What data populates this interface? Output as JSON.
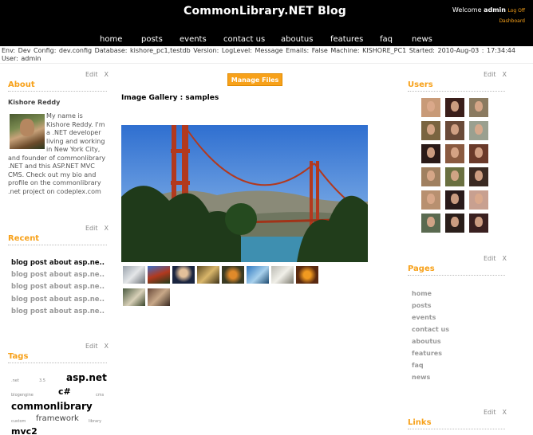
{
  "header": {
    "site_title": "CommonLibrary.NET Blog",
    "welcome_prefix": "Welcome ",
    "username": "admin",
    "logoff_label": "Log Off",
    "dashboard_label": "Dashboard"
  },
  "nav": {
    "items": [
      {
        "label": "home"
      },
      {
        "label": "posts"
      },
      {
        "label": "events"
      },
      {
        "label": "contact us"
      },
      {
        "label": "aboutus"
      },
      {
        "label": "features"
      },
      {
        "label": "faq"
      },
      {
        "label": "news"
      }
    ]
  },
  "env": {
    "text": "Env: Dev    Config: dev.config    Database: kishore_pc1,testdb    Version:    LogLevel: Message    Emails: False    Machine: KISHORE_PC1    Started: 2010-Aug-03 : 17:34:44    User: admin"
  },
  "widget_controls": {
    "edit": "Edit",
    "close": "X"
  },
  "about": {
    "title": "About",
    "name": "Kishore Reddy",
    "text": "My name is Kishore Reddy. I'm a .NET developer living and working in New York City, and founder of commonlibrary .NET and this ASP.NET MVC CMS. Check out my bio and profile on the commonlibrary .net project on codeplex.com"
  },
  "recent": {
    "title": "Recent",
    "items": [
      {
        "label": "blog post about asp.ne.."
      },
      {
        "label": "blog post about asp.ne.."
      },
      {
        "label": "blog post about asp.ne.."
      },
      {
        "label": "blog post about asp.ne.."
      },
      {
        "label": "blog post about asp.ne.."
      }
    ]
  },
  "tags": {
    "title": "Tags",
    "items": [
      {
        "label": ".net"
      },
      {
        "label": "3.5"
      },
      {
        "label": "asp.net"
      },
      {
        "label": "blogengine"
      },
      {
        "label": "c#"
      },
      {
        "label": "cms"
      },
      {
        "label": "commonlibrary"
      },
      {
        "label": "custom"
      },
      {
        "label": "framework"
      },
      {
        "label": "library"
      },
      {
        "label": "mvc2"
      }
    ]
  },
  "main": {
    "manage_files_label": "Manage Files",
    "gallery_title": "Image Gallery : samples"
  },
  "users": {
    "title": "Users"
  },
  "pages": {
    "title": "Pages",
    "items": [
      {
        "label": "home"
      },
      {
        "label": "posts"
      },
      {
        "label": "events"
      },
      {
        "label": "contact us"
      },
      {
        "label": "aboutus"
      },
      {
        "label": "features"
      },
      {
        "label": "faq"
      },
      {
        "label": "news"
      }
    ]
  },
  "links": {
    "title": "Links"
  },
  "colors": {
    "accent": "#f7a11a",
    "header_bg": "#000000"
  }
}
